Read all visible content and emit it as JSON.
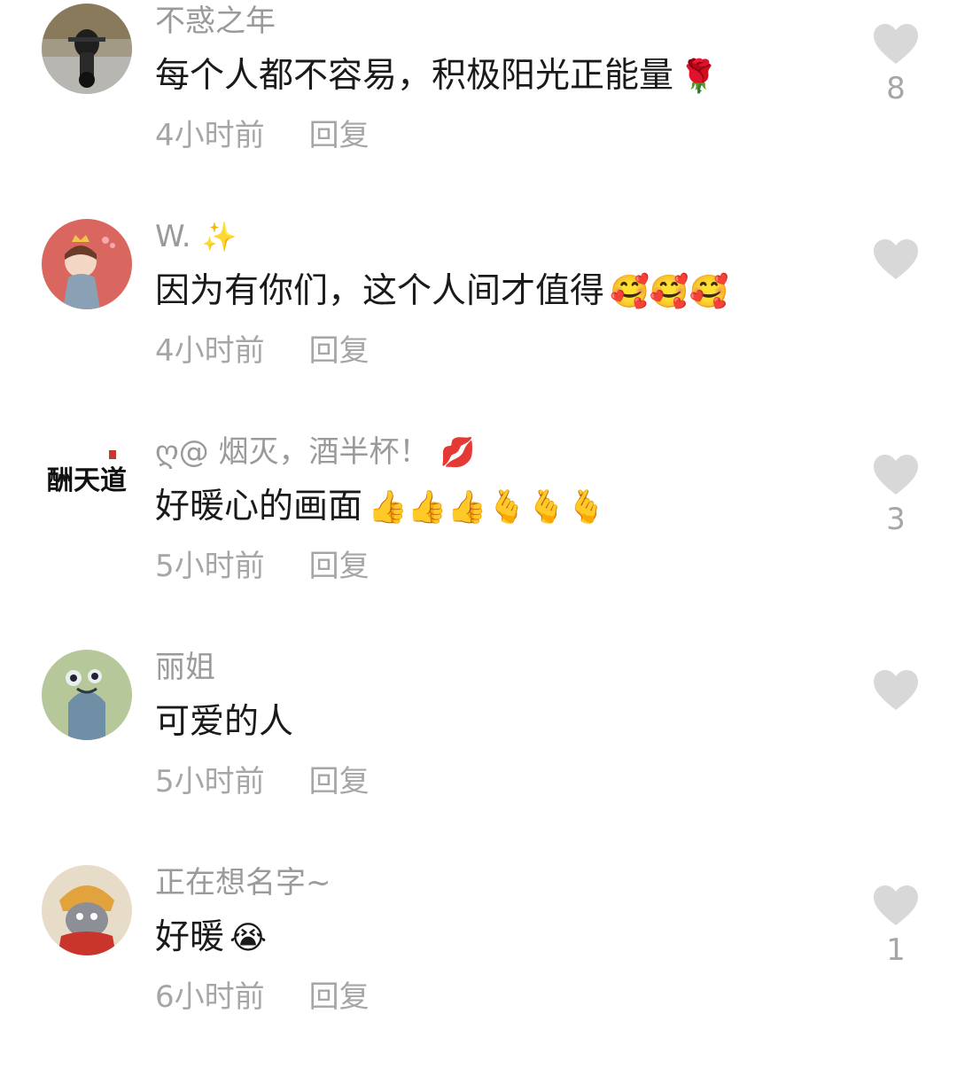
{
  "comments": [
    {
      "username": "不惑之年",
      "username_deco": "",
      "text": "每个人都不容易，积极阳光正能量",
      "emoji": "🌹",
      "time": "4小时前",
      "reply_label": "回复",
      "likes": "8",
      "avatar_icon": "motorcycle-photo-avatar"
    },
    {
      "username": "W.",
      "username_deco": "✨",
      "text": "因为有你们，这个人间才值得",
      "emoji": "🥰🥰🥰",
      "time": "4小时前",
      "reply_label": "回复",
      "likes": "",
      "avatar_icon": "princess-cartoon-avatar"
    },
    {
      "username": "ღ@ 烟灭，酒半杯！",
      "username_deco": "💋",
      "text": "好暖心的画面",
      "emoji": "👍👍👍🫰🫰🫰",
      "time": "5小时前",
      "reply_label": "回复",
      "likes": "3",
      "avatar_icon": "calligraphy-avatar",
      "avatar_calligraphy": "酬天道"
    },
    {
      "username": "丽姐",
      "username_deco": "",
      "text": "可爱的人",
      "emoji": "",
      "time": "5小时前",
      "reply_label": "回复",
      "likes": "",
      "avatar_icon": "cartoon-creature-avatar"
    },
    {
      "username": "正在想名字~",
      "username_deco": "",
      "text": "好暖",
      "emoji": "😭",
      "time": "6小时前",
      "reply_label": "回复",
      "likes": "1",
      "avatar_icon": "tom-cat-avatar"
    }
  ],
  "colors": {
    "username": "#9a9a9a",
    "text": "#1a1a1a",
    "meta": "#a6a6a6",
    "heart": "#d8d8d8"
  }
}
